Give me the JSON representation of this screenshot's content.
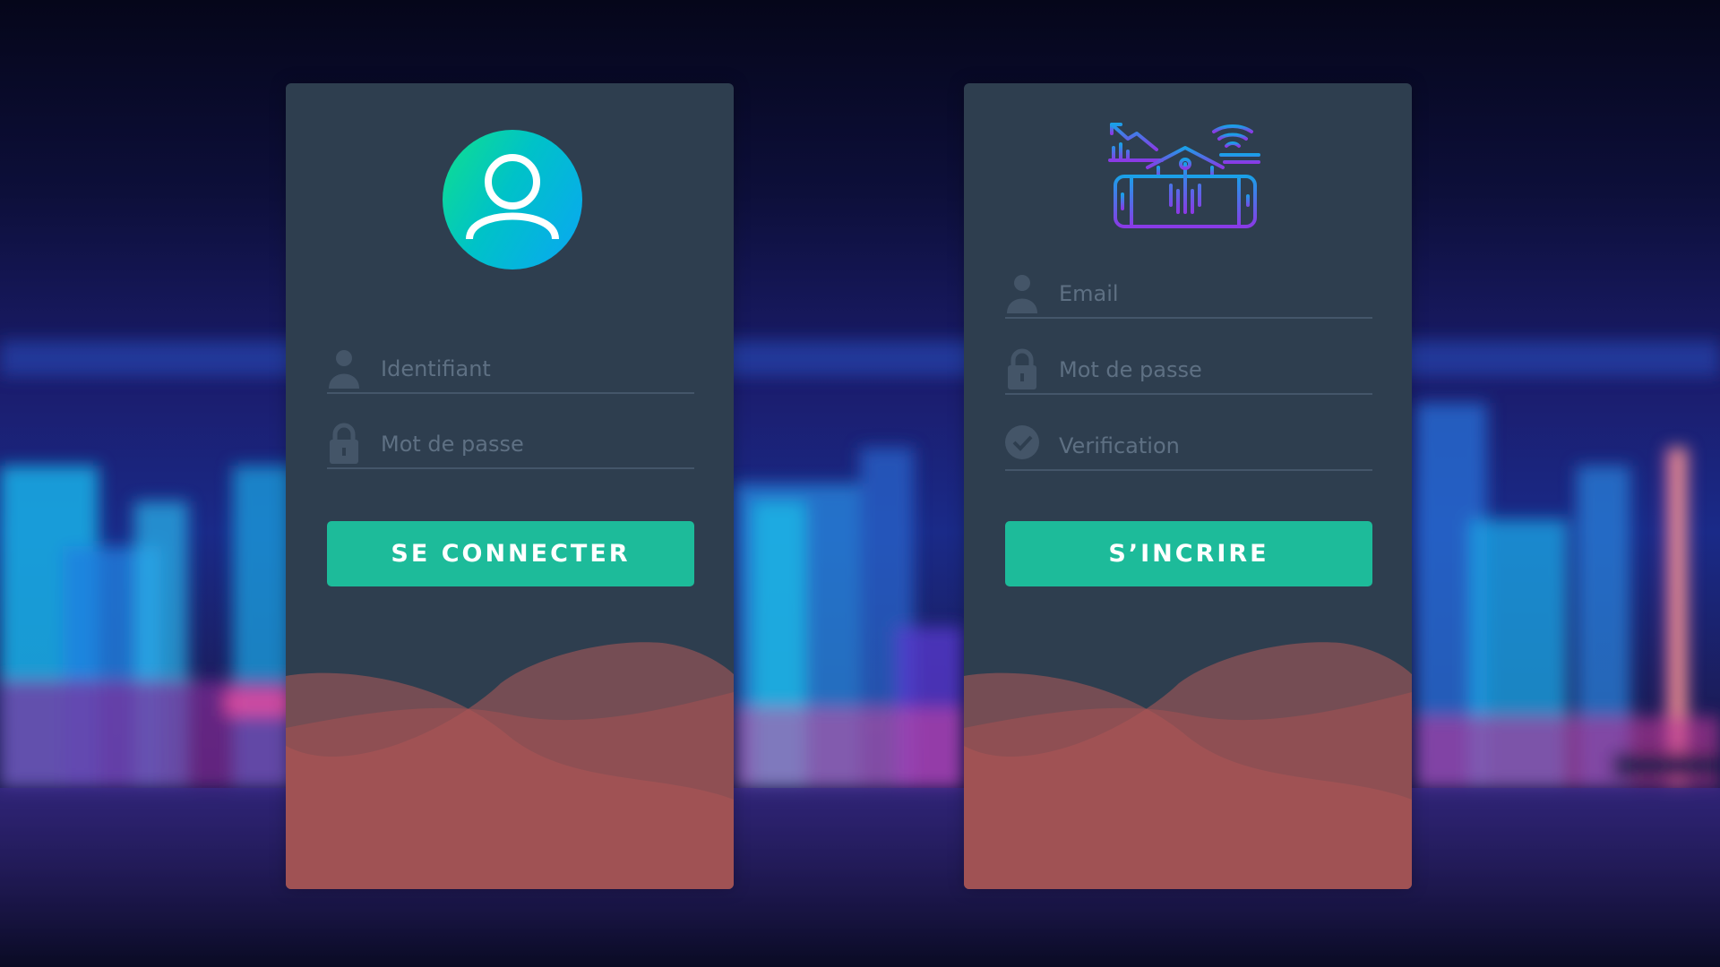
{
  "login_card": {
    "avatar_icon": "user-avatar-icon",
    "username": {
      "icon": "user-icon",
      "placeholder": "Identifiant",
      "value": ""
    },
    "password": {
      "icon": "lock-icon",
      "placeholder": "Mot de passe",
      "value": ""
    },
    "submit_label": "SE CONNECTER"
  },
  "register_card": {
    "logo_icon": "smart-home-icon",
    "email": {
      "icon": "user-icon",
      "placeholder": "Email",
      "value": ""
    },
    "password": {
      "icon": "lock-icon",
      "placeholder": "Mot de passe",
      "value": ""
    },
    "verification": {
      "icon": "check-circle-icon",
      "placeholder": "Verification",
      "value": ""
    },
    "submit_label": "S’INCRIRE"
  },
  "colors": {
    "card_bg": "#2e3e4f",
    "button_bg": "#1dbb9a",
    "wave": "#b05a5a",
    "placeholder": "#5e7083",
    "avatar_gradient_start": "#10e08c",
    "avatar_gradient_end": "#0aa6f4"
  }
}
